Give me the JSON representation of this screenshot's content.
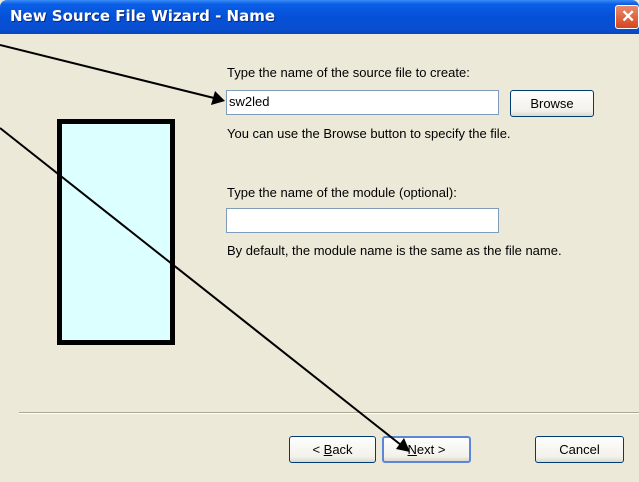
{
  "window": {
    "title": "New Source File Wizard - Name",
    "close_glyph": "✕"
  },
  "source_file": {
    "prompt": "Type the name of the source file to create:",
    "value": "sw2led",
    "browse_label": "Browse",
    "hint": "You can use the Browse button to specify the file."
  },
  "module": {
    "prompt": "Type the name of the module (optional):",
    "value": "",
    "hint": "By default, the module name is the same as the file name."
  },
  "buttons": {
    "back_underline": "B",
    "back_rest": "ack",
    "next_underline": "N",
    "next_rest": "ext >",
    "cancel": "Cancel"
  },
  "colors": {
    "title_bar": "#0550d8",
    "picture_fill": "#dcffff",
    "face": "#ece9d8"
  }
}
